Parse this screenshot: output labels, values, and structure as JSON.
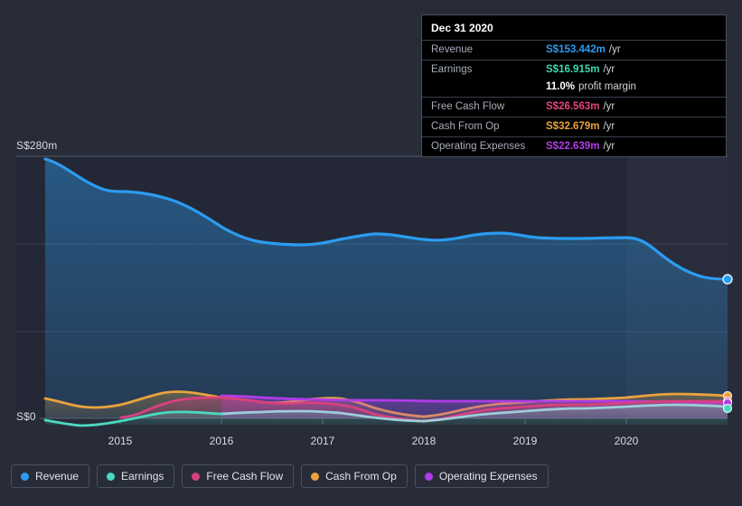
{
  "axis": {
    "y_top_label": "S$280m",
    "y_bottom_label": "S$0",
    "x_labels": [
      "2015",
      "2016",
      "2017",
      "2018",
      "2019",
      "2020"
    ]
  },
  "tooltip": {
    "date": "Dec 31 2020",
    "rows": [
      {
        "key": "Revenue",
        "value": "S$153.442m",
        "unit": "/yr",
        "color": "#2b9cf0"
      },
      {
        "key": "Earnings",
        "value": "S$16.915m",
        "unit": "/yr",
        "color": "#38d9b0"
      },
      {
        "key": "margin",
        "value": "11.0%",
        "unit": "profit margin",
        "color": "#ffffff"
      },
      {
        "key": "Free Cash Flow",
        "value": "S$26.563m",
        "unit": "/yr",
        "color": "#e8447e"
      },
      {
        "key": "Cash From Op",
        "value": "S$32.679m",
        "unit": "/yr",
        "color": "#e8a33d"
      },
      {
        "key": "Operating Expenses",
        "value": "S$22.639m",
        "unit": "/yr",
        "color": "#b03ce8"
      }
    ]
  },
  "legend": {
    "items": [
      {
        "label": "Revenue",
        "color": "#2b9cf0"
      },
      {
        "label": "Earnings",
        "color": "#4ad9c0"
      },
      {
        "label": "Free Cash Flow",
        "color": "#d6417f"
      },
      {
        "label": "Cash From Op",
        "color": "#e8a33d"
      },
      {
        "label": "Operating Expenses",
        "color": "#b03ce8"
      }
    ]
  },
  "chart_data": {
    "type": "area",
    "title": "",
    "xlabel": "",
    "ylabel": "S$",
    "ylim": [
      0,
      280
    ],
    "y_ticks": [
      0,
      93.3,
      186.7,
      280
    ],
    "grid": true,
    "legend_position": "bottom",
    "currency": "S$",
    "units": "m per year",
    "x": [
      "2014.3",
      "2014.6",
      "2015.0",
      "2015.3",
      "2015.6",
      "2016.0",
      "2016.3",
      "2016.6",
      "2017.0",
      "2017.3",
      "2017.6",
      "2018.0",
      "2018.3",
      "2018.6",
      "2019.0",
      "2019.3",
      "2019.6",
      "2020.0",
      "2020.3",
      "2020.6",
      "2021.0"
    ],
    "x_tick_values": [
      2015,
      2016,
      2017,
      2018,
      2019,
      2020
    ],
    "series": [
      {
        "name": "Revenue",
        "color": "#2b9cf0",
        "values": [
          277,
          262,
          248,
          246,
          243,
          238,
          227,
          214,
          204,
          201,
          203,
          207,
          212,
          208,
          206,
          206,
          205,
          203,
          186,
          163,
          153.442
        ]
      },
      {
        "name": "Earnings",
        "color": "#4ad9c0",
        "values": [
          -2,
          -6,
          -5,
          -1,
          2,
          5,
          8,
          10,
          12,
          12,
          11,
          10,
          7,
          4,
          6,
          8,
          10,
          12,
          14,
          16,
          16.915
        ]
      },
      {
        "name": "Free Cash Flow",
        "color": "#d6417f",
        "values": [
          null,
          null,
          2,
          8,
          16,
          27,
          26,
          23,
          20,
          19,
          18,
          16,
          12,
          8,
          13,
          18,
          22,
          24,
          25,
          26,
          26.563
        ]
      },
      {
        "name": "Cash From Op",
        "color": "#e8a33d",
        "values": [
          21,
          17,
          16,
          21,
          29,
          32,
          31,
          28,
          25,
          24,
          25,
          26,
          20,
          13,
          18,
          23,
          26,
          28,
          31,
          33,
          32.679
        ]
      },
      {
        "name": "Operating Expenses",
        "color": "#b03ce8",
        "values": [
          null,
          null,
          null,
          null,
          null,
          24,
          24,
          23,
          23,
          23,
          23,
          23,
          23,
          23,
          23,
          23,
          23,
          23,
          23,
          23,
          22.639
        ]
      }
    ],
    "annotations": [
      {
        "type": "highlight-band",
        "from": "2020.0",
        "to": "2021.0",
        "note": "recent period shading"
      }
    ]
  }
}
